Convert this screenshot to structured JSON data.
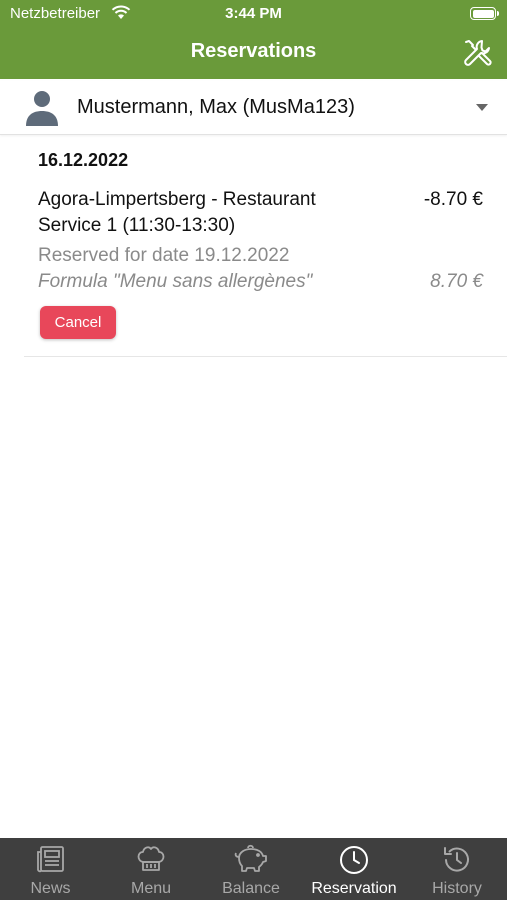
{
  "status_bar": {
    "carrier": "Netzbetreiber",
    "time": "3:44 PM"
  },
  "header": {
    "title": "Reservations",
    "settings_icon": "tools-icon"
  },
  "user_selector": {
    "name": "Mustermann, Max (MusMa123)",
    "icon": "person-icon"
  },
  "reservations": [
    {
      "date": "16.12.2022",
      "place": "Agora-Limpertsberg - Restaurant Service 1 (11:30-13:30)",
      "amount": "-8.70 €",
      "reserved_for": "Reserved for date 19.12.2022",
      "formula": "Formula \"Menu sans allergènes\"",
      "formula_amount": "8.70 €",
      "cancel_label": "Cancel"
    }
  ],
  "colors": {
    "header": "#6a9a3a",
    "cancel": "#e8475a",
    "tabbar": "#3f3f3f"
  },
  "tabs": [
    {
      "label": "News",
      "icon": "news-icon",
      "active": false
    },
    {
      "label": "Menu",
      "icon": "chef-hat-icon",
      "active": false
    },
    {
      "label": "Balance",
      "icon": "piggy-bank-icon",
      "active": false
    },
    {
      "label": "Reservation",
      "icon": "clock-icon",
      "active": true
    },
    {
      "label": "History",
      "icon": "history-icon",
      "active": false
    }
  ]
}
